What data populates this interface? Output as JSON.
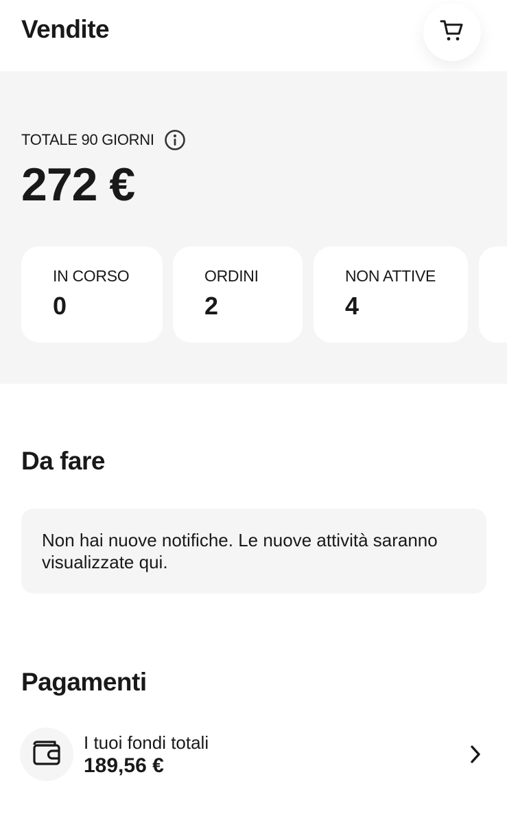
{
  "header": {
    "title": "Vendite",
    "cart_icon": "cart-icon"
  },
  "summary": {
    "total_label": "TOTALE 90 GIORNI",
    "info_icon": "info-icon",
    "total_value": "272 €",
    "stats": [
      {
        "label": "IN CORSO",
        "value": "0"
      },
      {
        "label": "ORDINI",
        "value": "2"
      },
      {
        "label": "NON ATTIVE",
        "value": "4"
      }
    ]
  },
  "todo": {
    "title": "Da fare",
    "notice": "Non hai nuove notifiche. Le nuove attività saranno visualizzate qui."
  },
  "payments": {
    "title": "Pagamenti",
    "funds_label": "I tuoi fondi totali",
    "funds_value": "189,56 €",
    "wallet_icon": "wallet-icon",
    "chevron_icon": "chevron-right-icon"
  }
}
